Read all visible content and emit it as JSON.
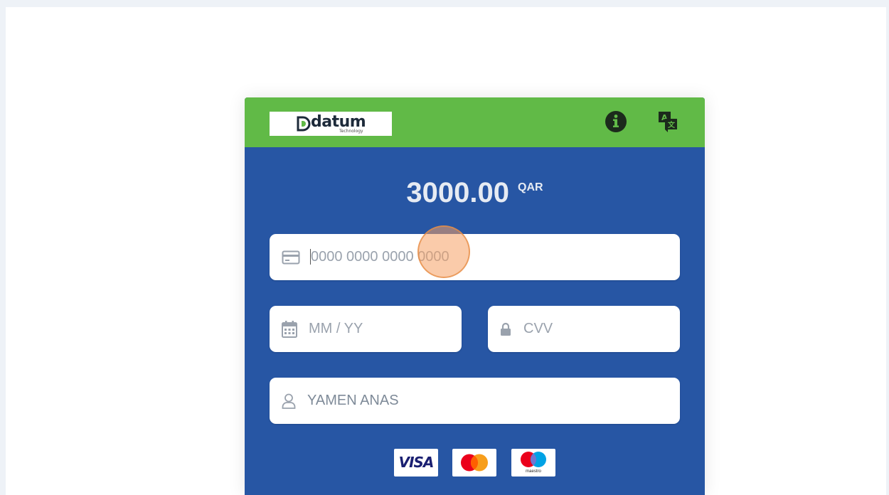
{
  "header": {
    "logo": {
      "word": "datum",
      "sub": "Technology"
    },
    "info_icon": "info-circle-icon",
    "translate_icon": "translate-icon",
    "colors": {
      "header_bg": "#61ba47",
      "card_bg": "#2756a4"
    }
  },
  "payment": {
    "amount": "3000.00",
    "currency": "QAR"
  },
  "form": {
    "card_number": {
      "value": "",
      "placeholder": "0000 0000 0000 0000",
      "icon": "credit-card-icon"
    },
    "expiry": {
      "value": "",
      "placeholder": "MM / YY",
      "icon": "calendar-icon"
    },
    "cvv": {
      "value": "",
      "placeholder": "CVV",
      "icon": "lock-icon"
    },
    "cardholder": {
      "value": "YAMEN ANAS",
      "placeholder": "",
      "icon": "user-icon"
    }
  },
  "brands": {
    "visa": "VISA",
    "mastercard": "mastercard",
    "maestro": "maestro"
  }
}
